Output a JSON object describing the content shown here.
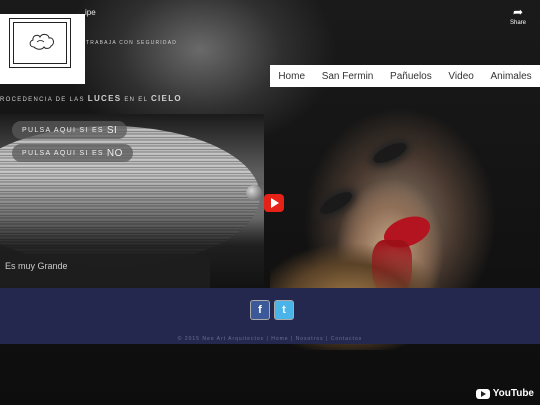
{
  "video": {
    "title": "ipe",
    "share_label": "Share",
    "subtitle_1": "TRABAJA CON SEGURIDAD",
    "subtitle_2_pre": "ROCEDENCIA DE LAS",
    "subtitle_2_luces": "LUCES",
    "subtitle_2_mid": "EN EL",
    "subtitle_2_cielo": "CIELO",
    "youtube_label": "YouTube"
  },
  "nav": {
    "items": [
      "Home",
      "San Fermin",
      "Pañuelos",
      "Video",
      "Animales"
    ]
  },
  "panel": {
    "pill_si_text": "PULSA AQUI SI ES",
    "pill_si_strong": "SI",
    "pill_no_text": "PULSA AQUI SI ES",
    "pill_no_strong": "NO",
    "caption": "Es muy Grande"
  },
  "footer": {
    "facebook_label": "f",
    "twitter_label": "t",
    "copyright": "© 2015 Neo Art Arquitectos | Home | Nosotros | Contactos"
  },
  "colors": {
    "footer_bg": "#25284e",
    "youtube_red": "#e62117",
    "facebook": "#3b5998",
    "twitter": "#4ab3e8"
  }
}
